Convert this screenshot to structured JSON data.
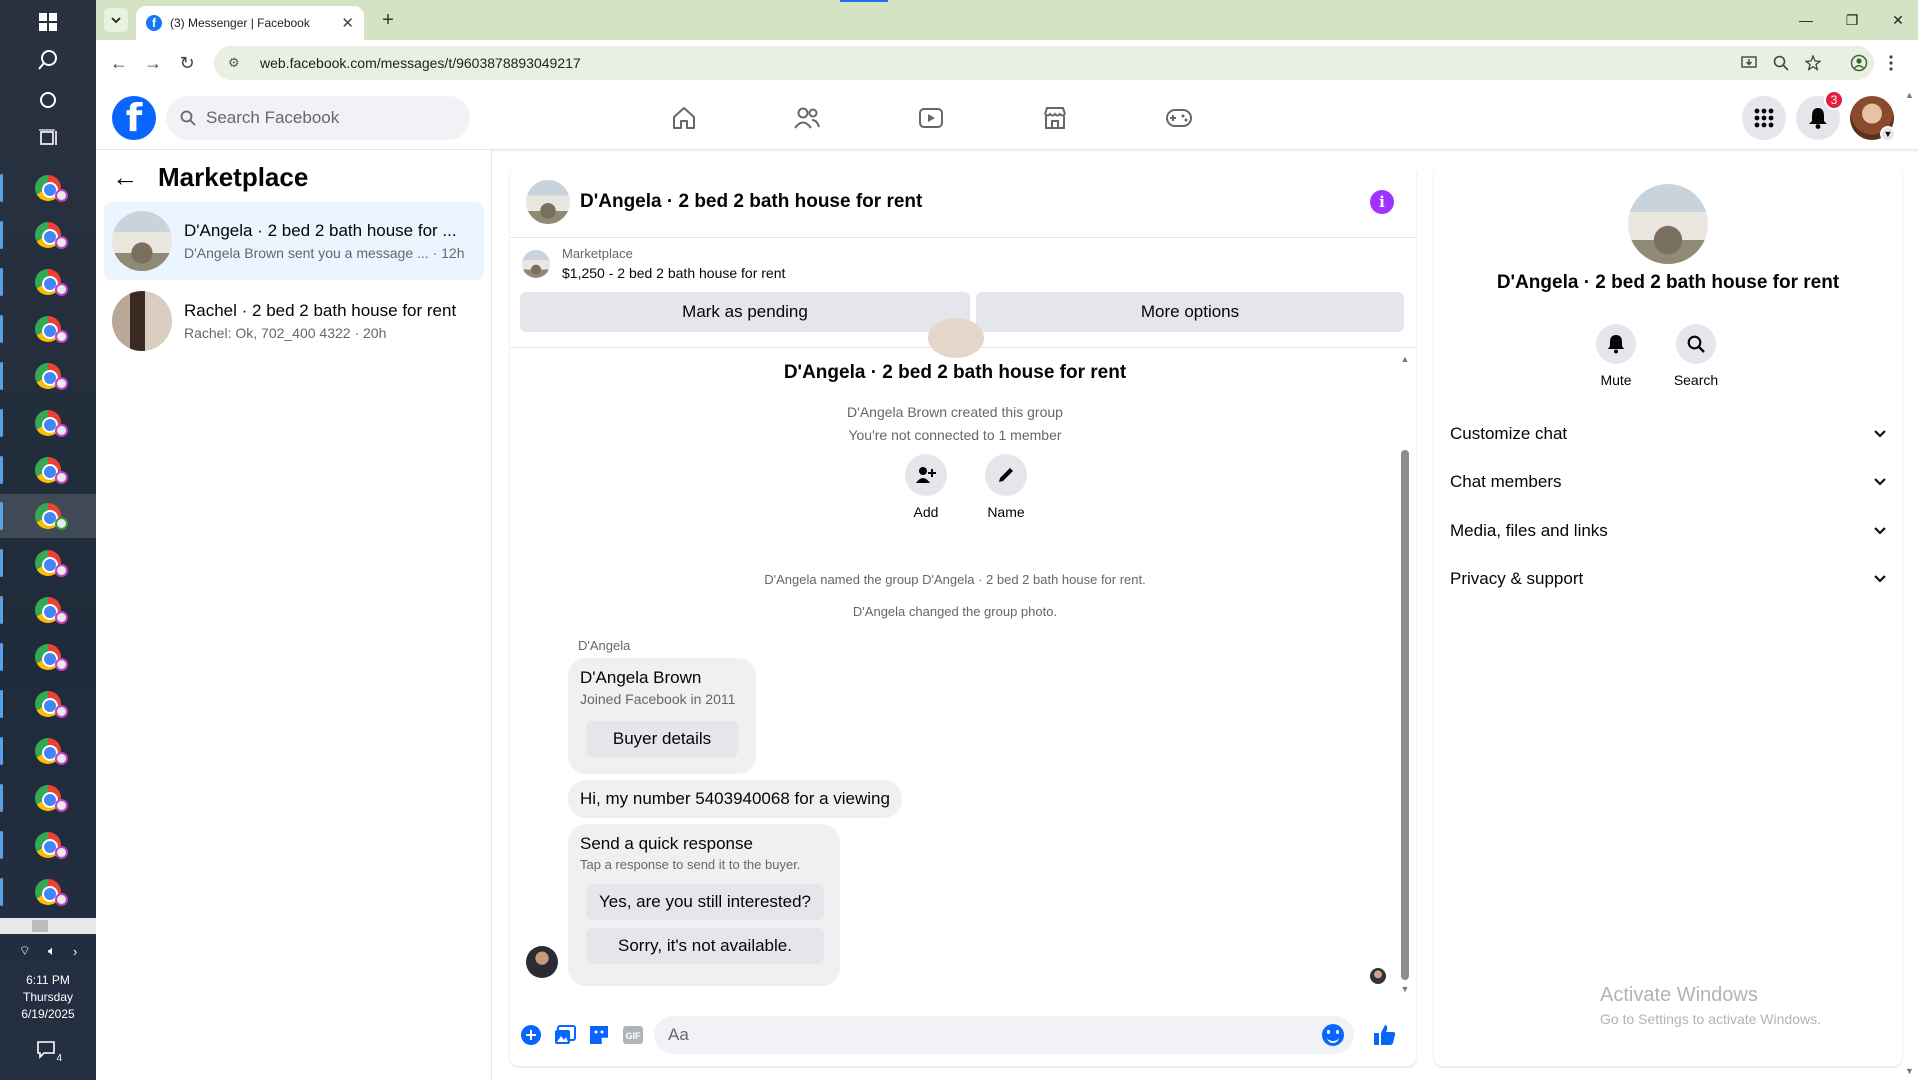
{
  "taskbar": {
    "time": "6:11 PM",
    "day": "Thursday",
    "date": "6/19/2025",
    "notification_count": "4"
  },
  "browser": {
    "tab_title": "(3) Messenger | Facebook",
    "url": "web.facebook.com/messages/t/9603878893049217"
  },
  "header": {
    "search_placeholder": "Search Facebook",
    "notification_badge": "3"
  },
  "left_panel": {
    "title": "Marketplace",
    "chats": [
      {
        "name": "D'Angela · 2 bed 2 bath house for ...",
        "preview": "D'Angela Brown sent you a message ... · 12h"
      },
      {
        "name": "Rachel · 2 bed 2 bath house for rent",
        "preview": "Rachel: Ok, 702_400 4322 · 20h"
      }
    ]
  },
  "conversation": {
    "title": "D'Angela · 2 bed 2 bath house for rent",
    "marketplace_label": "Marketplace",
    "listing": "$1,250 - 2 bed 2 bath house for rent",
    "mark_pending": "Mark as pending",
    "more_options": "More options",
    "group_title": "D'Angela · 2 bed 2 bath house for rent",
    "created_by": "D'Angela Brown created this group",
    "not_connected": "You're not connected to 1 member",
    "add_label": "Add",
    "name_label": "Name",
    "system_msg_1": "D'Angela named the group D'Angela · 2 bed 2 bath house for rent.",
    "system_msg_2": "D'Angela changed the group photo.",
    "sender": "D'Angela",
    "buyer_name": "D'Angela Brown",
    "buyer_joined": "Joined Facebook in 2011",
    "buyer_details": "Buyer details",
    "message": "Hi, my number 5403940068 for a viewing",
    "quick_title": "Send a quick response",
    "quick_sub": "Tap a response to send it to the buyer.",
    "quick_reply_1": "Yes, are you still interested?",
    "quick_reply_2": "Sorry, it's not available.",
    "composer_placeholder": "Aa"
  },
  "right_panel": {
    "title": "D'Angela · 2 bed 2 bath house for rent",
    "mute": "Mute",
    "search": "Search",
    "sections": [
      "Customize chat",
      "Chat members",
      "Media, files and links",
      "Privacy & support"
    ]
  },
  "watermark": {
    "title": "Activate Windows",
    "subtitle": "Go to Settings to activate Windows."
  },
  "colors": {
    "fb_blue": "#0866ff",
    "messenger_purple": "#a033ff",
    "active_chat_bg": "#ebf5ff",
    "badge_red": "#e41e3f"
  }
}
